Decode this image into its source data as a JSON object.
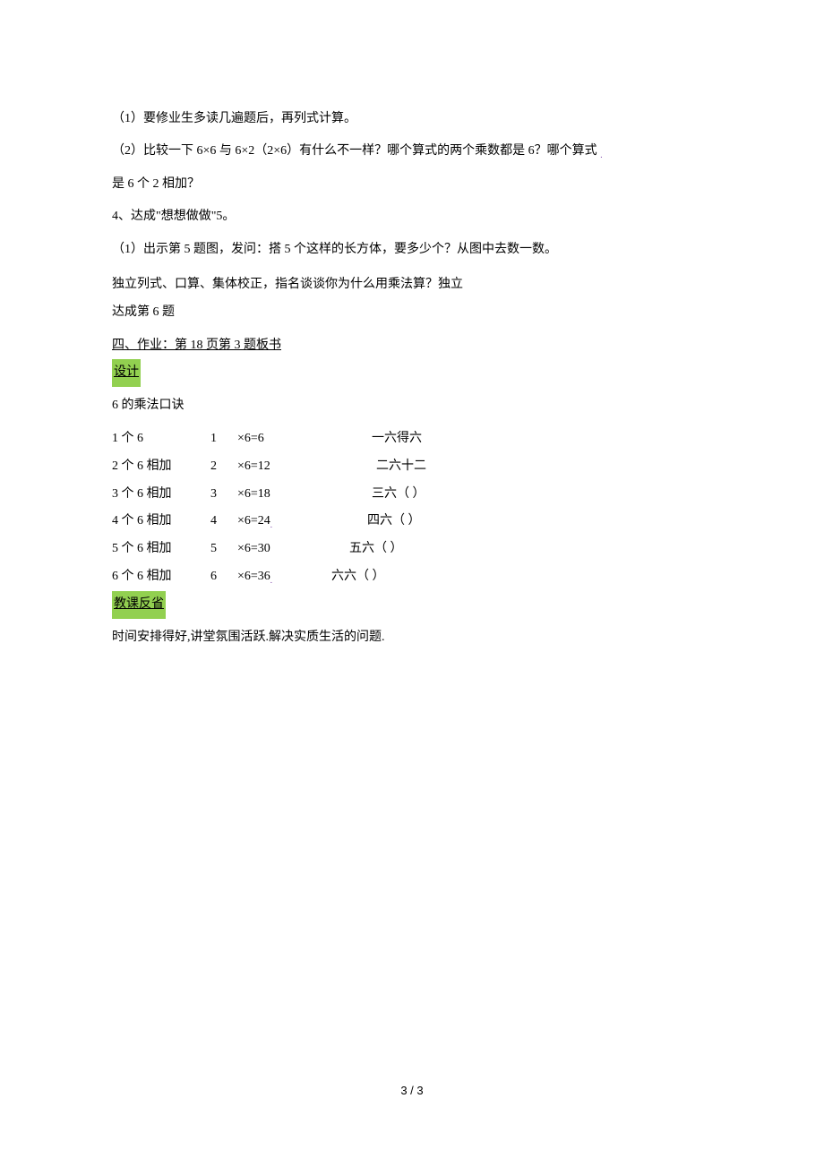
{
  "lines": {
    "l1": "（1）要修业生多读几遍题后，再列式计算。",
    "l2a": "（2）比较一下 6×6 与 6×2（2×6）有什么不一样？哪个算式的两个乘数都是 6？哪个算式",
    "l3": "是 6 个 2 相加？",
    "l4": "4、达成\"想想做做\"5。",
    "l5": "（1）出示第 5 题图，发问：搭 5 个这样的长方体，要多少个？从图中去数一数。",
    "l6": "独立列式、口算、集体校正，指名谈谈你为什么用乘法算？独立",
    "l6b": "达成第 6 题",
    "l7": "四、作业：第 18 页第 3 题板书",
    "design": "设计",
    "title6": "6 的乘法口诀",
    "reflect": "教课反省",
    "last": "时间安排得好,讲堂氛围活跃.解决实质生活的问题."
  },
  "table": {
    "rows": [
      {
        "c1": "1 个 6",
        "c2": "1",
        "c3": "×6=6",
        "c4": "一六得六",
        "mark": ""
      },
      {
        "c1": "2 个 6 相加",
        "c2": "2",
        "c3": "×6=12",
        "c4": "二六十二",
        "mark": ""
      },
      {
        "c1": "3 个 6 相加",
        "c2": "3",
        "c3": "×6=18",
        "c4": "三六（        ）",
        "mark": ""
      },
      {
        "c1": "4 个 6 相加",
        "c2": "4",
        "c3": "×6=24",
        "c4": "四六（        ）",
        "mark": "."
      },
      {
        "c1": "5 个 6 相加",
        "c2": "5",
        "c3": "×6=30",
        "c4": "五六（        ）",
        "mark": "",
        "indent": true
      },
      {
        "c1": "6 个 6 相加",
        "c2": "6",
        "c3": "×6=36",
        "c4": "六六（        ）",
        "mark": ".",
        "indent2": true
      }
    ]
  },
  "footer": "3 / 3"
}
